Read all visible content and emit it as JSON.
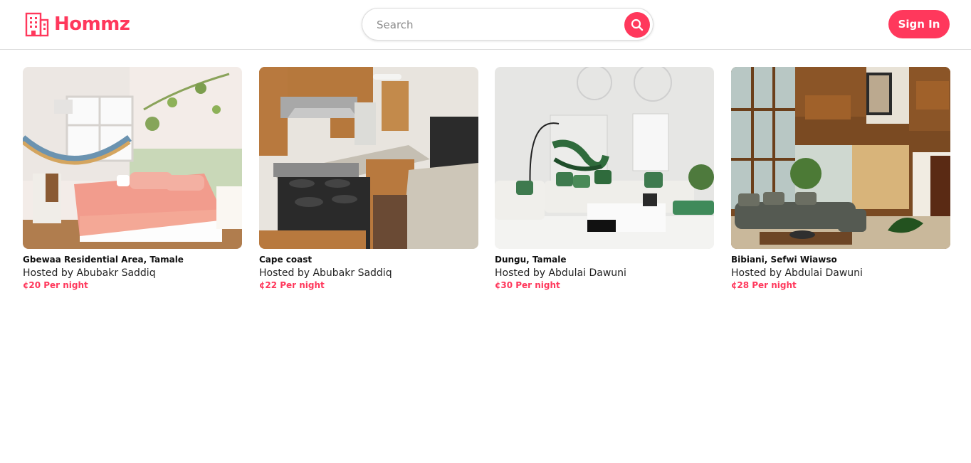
{
  "brand": {
    "name": "Hommz",
    "icon": "building-icon",
    "color": "#ff385c"
  },
  "search": {
    "placeholder": "Search",
    "value": "",
    "icon": "search-icon"
  },
  "auth": {
    "sign_in_label": "Sign In"
  },
  "listings": [
    {
      "location": "Gbewaa Residential Area, Tamale",
      "host": "Hosted by Abubakr Saddiq",
      "price": "¢20 Per night",
      "photo": "bedroom-photo"
    },
    {
      "location": "Cape coast",
      "host": "Hosted by Abubakr Saddiq",
      "price": "¢22 Per night",
      "photo": "kitchen-photo"
    },
    {
      "location": "Dungu, Tamale",
      "host": "Hosted by Abdulai Dawuni",
      "price": "¢30 Per night",
      "photo": "living-room-photo"
    },
    {
      "location": "Bibiani, Sefwi Wiawso",
      "host": "Hosted by Abdulai Dawuni",
      "price": "¢28 Per night",
      "photo": "lounge-photo"
    }
  ]
}
